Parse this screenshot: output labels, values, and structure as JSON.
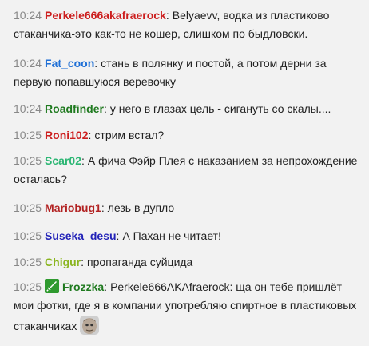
{
  "messages": [
    {
      "time": "10:24",
      "user": "Perkele666akafraerock",
      "color": "#cc1e1e",
      "text": "Belyaevv, водка из пластиково стаканчика-это как-то не кошер, слишком по быдловски."
    },
    {
      "time": "10:24",
      "user": "Fat_coon",
      "color": "#1e6fd6",
      "text": "стань в полянку и постой, а потом дерни за первую попавшуюся веревочку"
    },
    {
      "time": "10:24",
      "user": "Roadfinder",
      "color": "#1f7a1f",
      "text": "у него в глазах цель - сигануть со скалы...."
    },
    {
      "time": "10:25",
      "user": "Roni102",
      "color": "#cc1e1e",
      "text": "стрим встал?"
    },
    {
      "time": "10:25",
      "user": "Scar02",
      "color": "#2bb673",
      "text": "А фича Фэйр Плея с наказанием за непрохождение осталась?"
    },
    {
      "time": "10:25",
      "user": "Mariobug1",
      "color": "#b22222",
      "text": "лезь в дупло"
    },
    {
      "time": "10:25",
      "user": "Suseka_desu",
      "color": "#2323b8",
      "text": "А Пахан не читает!"
    },
    {
      "time": "10:25",
      "user": "Chigur",
      "color": "#8ab51f",
      "text": "пропаганда суйцида"
    },
    {
      "time": "10:25",
      "user": "Frozzka",
      "color": "#1f7a1f",
      "text": "Perkele666AKAfraerock: ща он тебе пришлёт мои фотки, где я в компании употребляю спиртное в пластиковых стаканчиках",
      "badge": "sword-icon",
      "emote": "face-emote-icon"
    }
  ]
}
